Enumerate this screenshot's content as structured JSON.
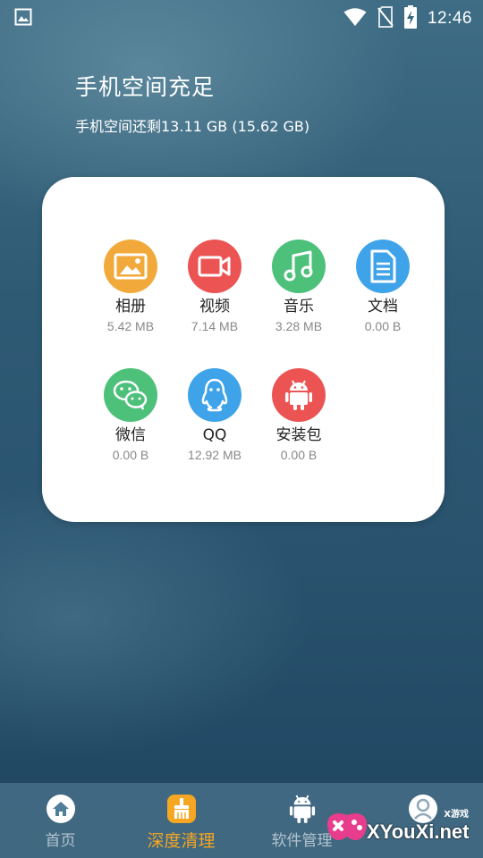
{
  "status_bar": {
    "time": "12:46",
    "icons": [
      "image-icon",
      "wifi-icon",
      "no-sim-icon",
      "battery-charging-icon"
    ]
  },
  "header": {
    "title": "手机空间充足",
    "subtitle": "手机空间还剩13.11 GB (15.62 GB)"
  },
  "categories": [
    {
      "label": "相册",
      "size": "5.42 MB",
      "icon": "photo-icon",
      "color": "#f2a93b"
    },
    {
      "label": "视频",
      "size": "7.14 MB",
      "icon": "video-icon",
      "color": "#ec5454"
    },
    {
      "label": "音乐",
      "size": "3.28 MB",
      "icon": "music-icon",
      "color": "#4dc07a"
    },
    {
      "label": "文档",
      "size": "0.00 B",
      "icon": "document-icon",
      "color": "#3fa3ea"
    },
    {
      "label": "微信",
      "size": "0.00 B",
      "icon": "wechat-icon",
      "color": "#4dc07a"
    },
    {
      "label": "QQ",
      "size": "12.92 MB",
      "icon": "qq-icon",
      "color": "#3fa3ea"
    },
    {
      "label": "安装包",
      "size": "0.00 B",
      "icon": "android-icon",
      "color": "#ec5454"
    }
  ],
  "bottom_nav": [
    {
      "label": "首页",
      "icon": "home-icon",
      "active": false
    },
    {
      "label": "深度清理",
      "icon": "broom-icon",
      "active": true
    },
    {
      "label": "软件管理",
      "icon": "android-icon",
      "active": false
    },
    {
      "label": "",
      "icon": "user-icon",
      "active": false
    }
  ],
  "watermark": {
    "text": "XYouXi.net",
    "small": "X游戏"
  },
  "colors": {
    "accent": "#f5a623",
    "card_bg": "#ffffff"
  }
}
